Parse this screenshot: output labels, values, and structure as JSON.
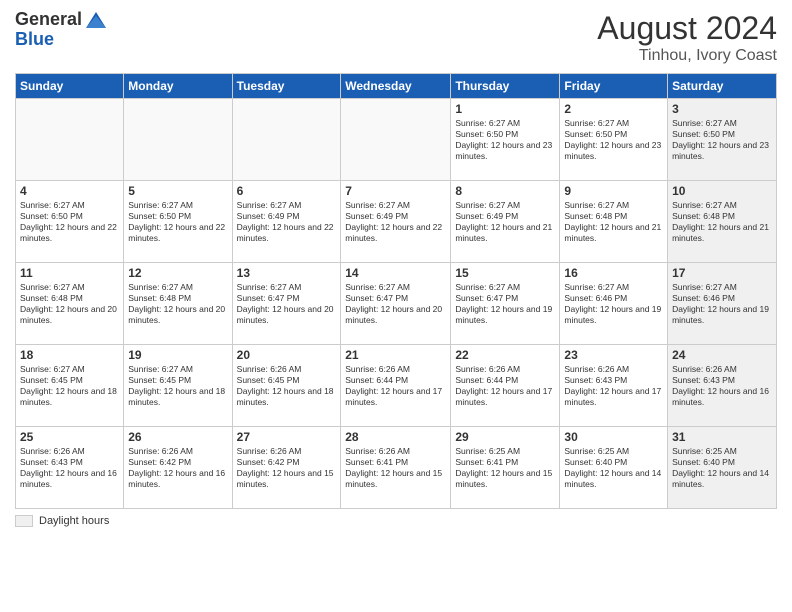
{
  "header": {
    "logo": {
      "general": "General",
      "blue": "Blue"
    },
    "title": "August 2024",
    "subtitle": "Tinhou, Ivory Coast"
  },
  "days_of_week": [
    "Sunday",
    "Monday",
    "Tuesday",
    "Wednesday",
    "Thursday",
    "Friday",
    "Saturday"
  ],
  "weeks": [
    {
      "days": [
        {
          "num": "",
          "empty": true
        },
        {
          "num": "",
          "empty": true
        },
        {
          "num": "",
          "empty": true
        },
        {
          "num": "",
          "empty": true
        },
        {
          "num": "1",
          "sunrise": "6:27 AM",
          "sunset": "6:50 PM",
          "daylight": "12 hours and 23 minutes."
        },
        {
          "num": "2",
          "sunrise": "6:27 AM",
          "sunset": "6:50 PM",
          "daylight": "12 hours and 23 minutes."
        },
        {
          "num": "3",
          "sunrise": "6:27 AM",
          "sunset": "6:50 PM",
          "daylight": "12 hours and 23 minutes.",
          "shaded": true
        }
      ]
    },
    {
      "days": [
        {
          "num": "4",
          "sunrise": "6:27 AM",
          "sunset": "6:50 PM",
          "daylight": "12 hours and 22 minutes."
        },
        {
          "num": "5",
          "sunrise": "6:27 AM",
          "sunset": "6:50 PM",
          "daylight": "12 hours and 22 minutes."
        },
        {
          "num": "6",
          "sunrise": "6:27 AM",
          "sunset": "6:49 PM",
          "daylight": "12 hours and 22 minutes."
        },
        {
          "num": "7",
          "sunrise": "6:27 AM",
          "sunset": "6:49 PM",
          "daylight": "12 hours and 22 minutes."
        },
        {
          "num": "8",
          "sunrise": "6:27 AM",
          "sunset": "6:49 PM",
          "daylight": "12 hours and 21 minutes."
        },
        {
          "num": "9",
          "sunrise": "6:27 AM",
          "sunset": "6:48 PM",
          "daylight": "12 hours and 21 minutes."
        },
        {
          "num": "10",
          "sunrise": "6:27 AM",
          "sunset": "6:48 PM",
          "daylight": "12 hours and 21 minutes.",
          "shaded": true
        }
      ]
    },
    {
      "days": [
        {
          "num": "11",
          "sunrise": "6:27 AM",
          "sunset": "6:48 PM",
          "daylight": "12 hours and 20 minutes."
        },
        {
          "num": "12",
          "sunrise": "6:27 AM",
          "sunset": "6:48 PM",
          "daylight": "12 hours and 20 minutes."
        },
        {
          "num": "13",
          "sunrise": "6:27 AM",
          "sunset": "6:47 PM",
          "daylight": "12 hours and 20 minutes."
        },
        {
          "num": "14",
          "sunrise": "6:27 AM",
          "sunset": "6:47 PM",
          "daylight": "12 hours and 20 minutes."
        },
        {
          "num": "15",
          "sunrise": "6:27 AM",
          "sunset": "6:47 PM",
          "daylight": "12 hours and 19 minutes."
        },
        {
          "num": "16",
          "sunrise": "6:27 AM",
          "sunset": "6:46 PM",
          "daylight": "12 hours and 19 minutes."
        },
        {
          "num": "17",
          "sunrise": "6:27 AM",
          "sunset": "6:46 PM",
          "daylight": "12 hours and 19 minutes.",
          "shaded": true
        }
      ]
    },
    {
      "days": [
        {
          "num": "18",
          "sunrise": "6:27 AM",
          "sunset": "6:45 PM",
          "daylight": "12 hours and 18 minutes."
        },
        {
          "num": "19",
          "sunrise": "6:27 AM",
          "sunset": "6:45 PM",
          "daylight": "12 hours and 18 minutes."
        },
        {
          "num": "20",
          "sunrise": "6:26 AM",
          "sunset": "6:45 PM",
          "daylight": "12 hours and 18 minutes."
        },
        {
          "num": "21",
          "sunrise": "6:26 AM",
          "sunset": "6:44 PM",
          "daylight": "12 hours and 17 minutes."
        },
        {
          "num": "22",
          "sunrise": "6:26 AM",
          "sunset": "6:44 PM",
          "daylight": "12 hours and 17 minutes."
        },
        {
          "num": "23",
          "sunrise": "6:26 AM",
          "sunset": "6:43 PM",
          "daylight": "12 hours and 17 minutes."
        },
        {
          "num": "24",
          "sunrise": "6:26 AM",
          "sunset": "6:43 PM",
          "daylight": "12 hours and 16 minutes.",
          "shaded": true
        }
      ]
    },
    {
      "days": [
        {
          "num": "25",
          "sunrise": "6:26 AM",
          "sunset": "6:43 PM",
          "daylight": "12 hours and 16 minutes."
        },
        {
          "num": "26",
          "sunrise": "6:26 AM",
          "sunset": "6:42 PM",
          "daylight": "12 hours and 16 minutes."
        },
        {
          "num": "27",
          "sunrise": "6:26 AM",
          "sunset": "6:42 PM",
          "daylight": "12 hours and 15 minutes."
        },
        {
          "num": "28",
          "sunrise": "6:26 AM",
          "sunset": "6:41 PM",
          "daylight": "12 hours and 15 minutes."
        },
        {
          "num": "29",
          "sunrise": "6:25 AM",
          "sunset": "6:41 PM",
          "daylight": "12 hours and 15 minutes."
        },
        {
          "num": "30",
          "sunrise": "6:25 AM",
          "sunset": "6:40 PM",
          "daylight": "12 hours and 14 minutes."
        },
        {
          "num": "31",
          "sunrise": "6:25 AM",
          "sunset": "6:40 PM",
          "daylight": "12 hours and 14 minutes.",
          "shaded": true
        }
      ]
    }
  ],
  "legend": {
    "label": "Daylight hours"
  }
}
